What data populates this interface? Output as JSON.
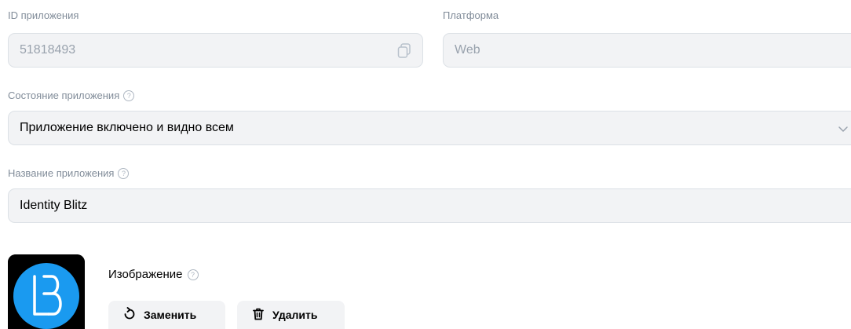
{
  "app_id": {
    "label": "ID приложения",
    "value": "51818493"
  },
  "platform": {
    "label": "Платформа",
    "value": "Web"
  },
  "app_state": {
    "label": "Состояние приложения",
    "value": "Приложение включено и видно всем"
  },
  "app_name": {
    "label": "Название приложения",
    "value": "Identity Blitz"
  },
  "image": {
    "title": "Изображение",
    "replace_label": "Заменить",
    "delete_label": "Удалить"
  },
  "help_glyph": "?",
  "icons": {
    "copy": "copy-icon",
    "chevron": "chevron-down-icon",
    "help": "help-icon",
    "replace": "refresh-icon",
    "delete": "trash-icon"
  },
  "colors": {
    "label": "#818c99",
    "field_bg": "#f2f3f5",
    "logo_blue": "#1a9af0"
  }
}
